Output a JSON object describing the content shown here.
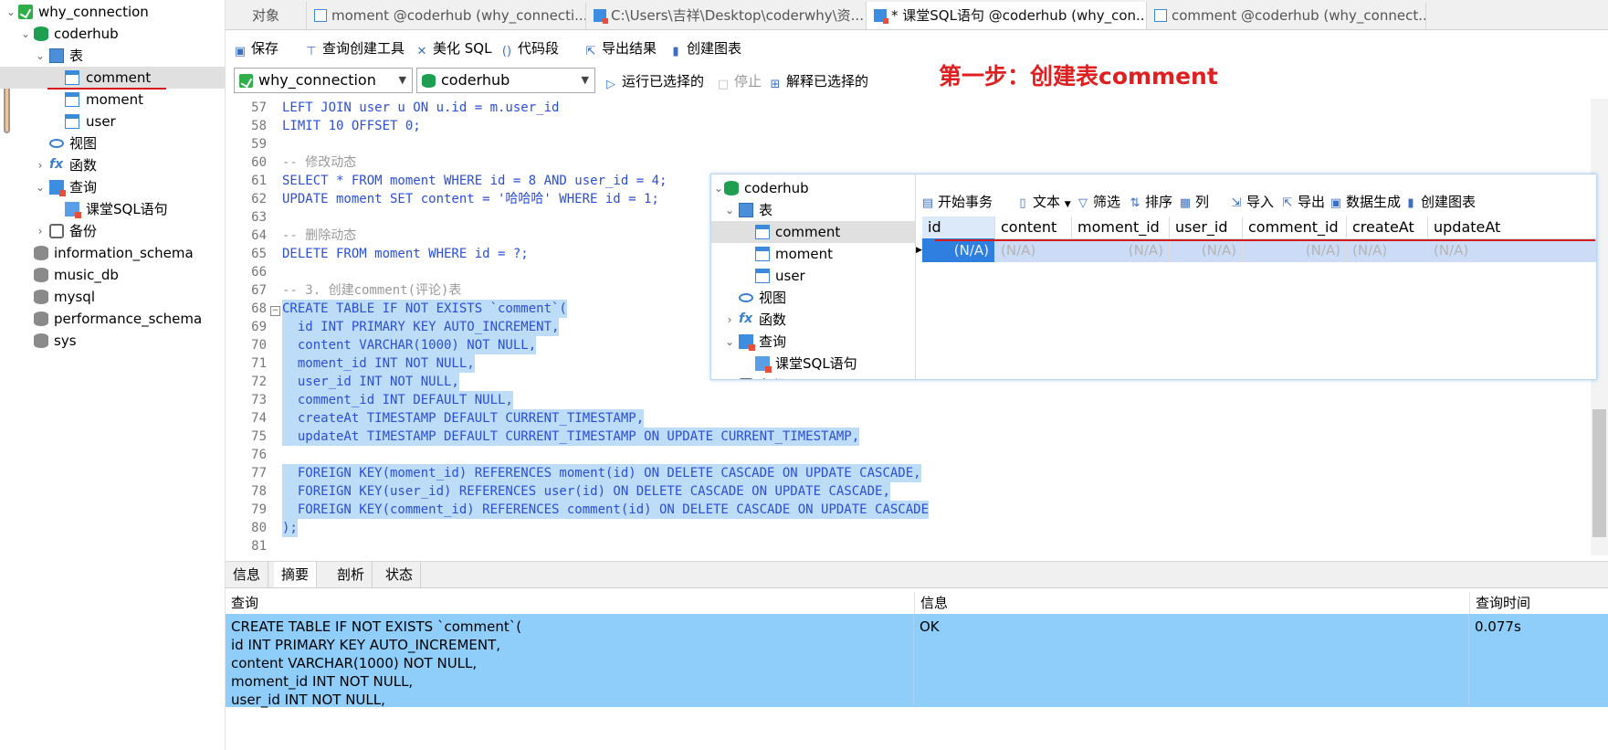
{
  "navigator": {
    "connection": "why_connection",
    "database": "coderhub",
    "tables_group": "表",
    "tables": [
      "comment",
      "moment",
      "user"
    ],
    "views_group": "视图",
    "functions_group": "函数",
    "queries_group": "查询",
    "query_item": "课堂SQL语句",
    "backup_group": "备份",
    "other_databases": [
      "information_schema",
      "music_db",
      "mysql",
      "performance_schema",
      "sys"
    ]
  },
  "tabs": [
    {
      "label": "对象",
      "icon": ""
    },
    {
      "label": "moment @coderhub (why_connecti...",
      "icon": "table-icon"
    },
    {
      "label": "C:\\Users\\吉祥\\Desktop\\coderwhy\\资...",
      "icon": "query-icon"
    },
    {
      "label": "* 课堂SQL语句 @coderhub (why_con...",
      "icon": "query-icon"
    },
    {
      "label": "comment @coderhub (why_connect...",
      "icon": "table-icon"
    }
  ],
  "toolbar": {
    "save": "保存",
    "query_builder": "查询创建工具",
    "beautify": "美化 SQL",
    "snippet": "代码段",
    "export_result": "导出结果",
    "create_chart": "创建图表",
    "connection_select": "why_connection",
    "database_select": "coderhub",
    "run_selected": "运行已选择的",
    "stop": "停止",
    "explain_selected": "解释已选择的"
  },
  "annotation": "第一步：创建表comment",
  "editor": {
    "lines": [
      {
        "n": "57",
        "text": "LEFT JOIN user u ON u.id = m.user_id"
      },
      {
        "n": "58",
        "text": "LIMIT 10 OFFSET 0;"
      },
      {
        "n": "59",
        "text": ""
      },
      {
        "n": "60",
        "text": "-- 修改动态"
      },
      {
        "n": "61",
        "text": "SELECT * FROM moment WHERE id = 8 AND user_id = 4;"
      },
      {
        "n": "62",
        "text": "UPDATE moment SET content = '哈哈哈' WHERE id = 1;"
      },
      {
        "n": "63",
        "text": ""
      },
      {
        "n": "64",
        "text": "-- 删除动态"
      },
      {
        "n": "65",
        "text": "DELETE FROM moment WHERE id = ?;"
      },
      {
        "n": "66",
        "text": ""
      },
      {
        "n": "67",
        "text": "-- 3. 创建comment(评论)表"
      },
      {
        "n": "68",
        "text": "CREATE TABLE IF NOT EXISTS `comment`("
      },
      {
        "n": "69",
        "text": "  id INT PRIMARY KEY AUTO_INCREMENT,"
      },
      {
        "n": "70",
        "text": "  content VARCHAR(1000) NOT NULL,"
      },
      {
        "n": "71",
        "text": "  moment_id INT NOT NULL,"
      },
      {
        "n": "72",
        "text": "  user_id INT NOT NULL,"
      },
      {
        "n": "73",
        "text": "  comment_id INT DEFAULT NULL,"
      },
      {
        "n": "74",
        "text": "  createAt TIMESTAMP DEFAULT CURRENT_TIMESTAMP,"
      },
      {
        "n": "75",
        "text": "  updateAt TIMESTAMP DEFAULT CURRENT_TIMESTAMP ON UPDATE CURRENT_TIMESTAMP,"
      },
      {
        "n": "76",
        "text": ""
      },
      {
        "n": "77",
        "text": "  FOREIGN KEY(moment_id) REFERENCES moment(id) ON DELETE CASCADE ON UPDATE CASCADE,"
      },
      {
        "n": "78",
        "text": "  FOREIGN KEY(user_id) REFERENCES user(id) ON DELETE CASCADE ON UPDATE CASCADE,"
      },
      {
        "n": "79",
        "text": "  FOREIGN KEY(comment_id) REFERENCES comment(id) ON DELETE CASCADE ON UPDATE CASCADE"
      },
      {
        "n": "80",
        "text": ");"
      },
      {
        "n": "81",
        "text": ""
      }
    ]
  },
  "popup": {
    "tree": {
      "database": "coderhub",
      "tables_group": "表",
      "tables": [
        "comment",
        "moment",
        "user"
      ],
      "views_group": "视图",
      "functions_group": "函数",
      "queries_group": "查询",
      "query_item": "课堂SQL语句",
      "partial_item": "备份"
    },
    "toolbar": {
      "begin_transaction": "开始事务",
      "text": "文本",
      "filter": "筛选",
      "sort": "排序",
      "columns": "列",
      "import": "导入",
      "export": "导出",
      "data_generation": "数据生成",
      "create_chart": "创建图表"
    },
    "columns": [
      "id",
      "content",
      "moment_id",
      "user_id",
      "comment_id",
      "createAt",
      "updateAt"
    ],
    "row_value": "(N/A)"
  },
  "result": {
    "tabs": [
      "信息",
      "摘要",
      "剖析",
      "状态"
    ],
    "active_tab": "摘要",
    "headers": {
      "query": "查询",
      "info": "信息",
      "time": "查询时间"
    },
    "row": {
      "query": "CREATE TABLE IF NOT EXISTS `comment`(\nid INT PRIMARY KEY AUTO_INCREMENT,\ncontent VARCHAR(1000) NOT NULL,\nmoment_id INT NOT NULL,\nuser_id INT NOT NULL,",
      "info": "OK",
      "time": "0.077s"
    }
  },
  "colors": {
    "annotation": "#e02020",
    "selection": "#bcdcf7",
    "result_row": "#8fcdfb",
    "keyword": "#2b4fd8"
  }
}
